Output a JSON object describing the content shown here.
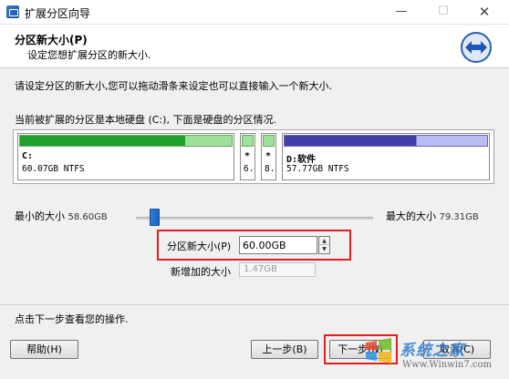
{
  "window": {
    "title": "扩展分区向导",
    "minimize_glyph": "—",
    "maximize_glyph": "☐",
    "close_glyph": "✕"
  },
  "header": {
    "title": "分区新大小(P)",
    "subtitle": "设定您想扩展分区的新大小.",
    "icon": "arrows-icon"
  },
  "instruction": "请设定分区的新大小,您可以拖动滑条来设定也可以直接输入一个新大小.",
  "disk_info": "当前被扩展的分区是本地硬盘 (C:), 下面是硬盘的分区情况.",
  "partitions": [
    {
      "label": "C:",
      "size": "60.07GB NTFS",
      "used_fraction": 0.78,
      "color": "#1fa02a"
    },
    {
      "label": "*",
      "size": "6.",
      "used_fraction": 0.0,
      "color": "#9fe09a"
    },
    {
      "label": "*",
      "size": "8.",
      "used_fraction": 0.0,
      "color": "#9fe09a"
    },
    {
      "label": "D:软件",
      "size": "57.77GB NTFS",
      "used_fraction": 0.65,
      "color": "#3b3fa6"
    }
  ],
  "slider": {
    "min_label": "最小的大小",
    "min_value": "58.60GB",
    "max_label": "最大的大小",
    "max_value": "79.31GB"
  },
  "new_size": {
    "label": "分区新大小(P)",
    "value": "60.00GB"
  },
  "added_size": {
    "label": "新增加的大小",
    "value": "1.47GB"
  },
  "bottom_text": "点击下一步查看您的操作.",
  "buttons": {
    "help": "帮助(H)",
    "back": "上一步(B)",
    "next": "下一步(N)",
    "cancel": "取消(C)"
  },
  "watermark": {
    "brand": "系统之家",
    "url": "Www.Winwin7.com"
  }
}
